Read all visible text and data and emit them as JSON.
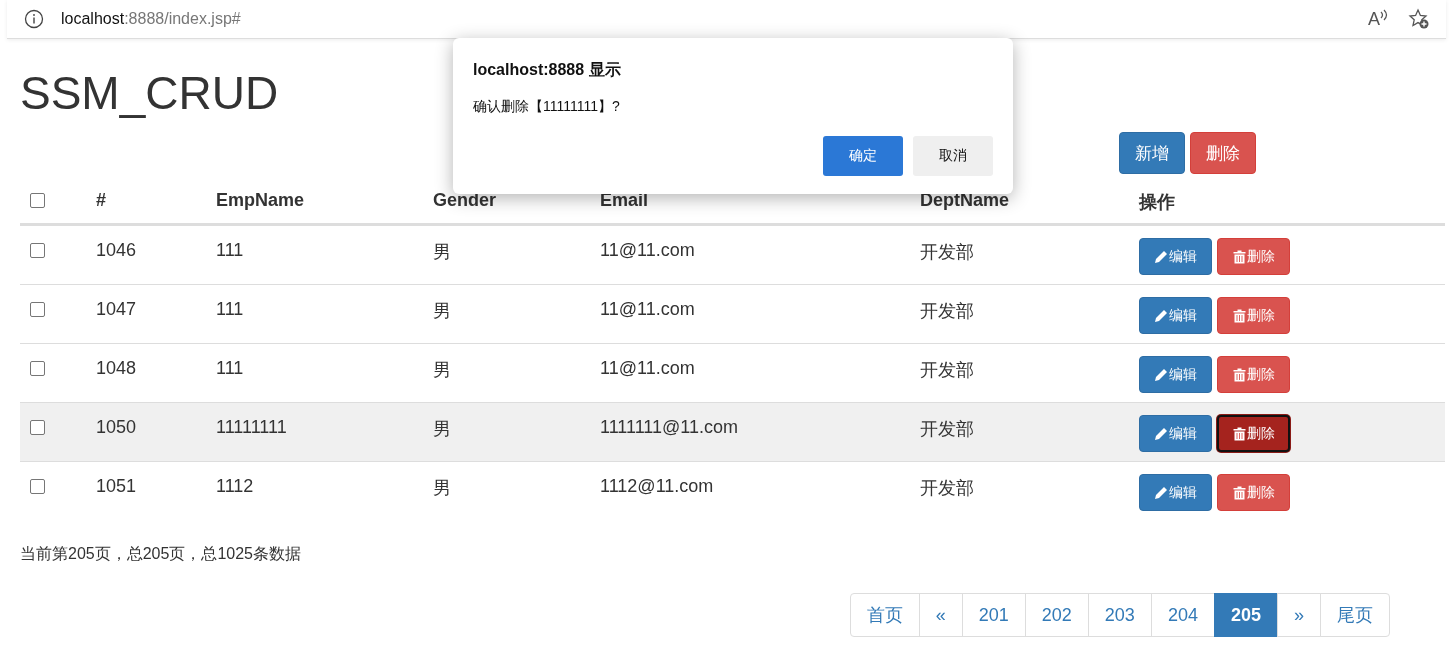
{
  "browser": {
    "url_host": "localhost",
    "url_path": ":8888/index.jsp#",
    "read_aloud_glyph": "A"
  },
  "title": "SSM_CRUD",
  "toolbar": [
    {
      "label": "新增",
      "kind": "primary"
    },
    {
      "label": "删除",
      "kind": "danger"
    }
  ],
  "table": {
    "select_all": {
      "checked": false
    },
    "columns": [
      "#",
      "EmpName",
      "Gender",
      "Email",
      "DeptName",
      "操作"
    ],
    "rows": [
      {
        "checked": false,
        "highlighted": false,
        "cells": [
          "1046",
          "111",
          "男",
          "11@11.com",
          "开发部"
        ],
        "edit": "编辑",
        "delete": "删除",
        "delete_focused": false
      },
      {
        "checked": false,
        "highlighted": false,
        "cells": [
          "1047",
          "111",
          "男",
          "11@11.com",
          "开发部"
        ],
        "edit": "编辑",
        "delete": "删除",
        "delete_focused": false
      },
      {
        "checked": false,
        "highlighted": false,
        "cells": [
          "1048",
          "111",
          "男",
          "11@11.com",
          "开发部"
        ],
        "edit": "编辑",
        "delete": "删除",
        "delete_focused": false
      },
      {
        "checked": false,
        "highlighted": true,
        "cells": [
          "1050",
          "11111111",
          "男",
          "1111111@11.com",
          "开发部"
        ],
        "edit": "编辑",
        "delete": "删除",
        "delete_focused": true
      },
      {
        "checked": false,
        "highlighted": false,
        "cells": [
          "1051",
          "1112",
          "男",
          "1112@11.com",
          "开发部"
        ],
        "edit": "编辑",
        "delete": "删除",
        "delete_focused": false
      }
    ]
  },
  "page_info": "当前第205页，总205页，总1025条数据",
  "pagination": [
    {
      "label": "首页",
      "selected": false
    },
    {
      "label": "«",
      "selected": false
    },
    {
      "label": "201",
      "selected": false
    },
    {
      "label": "202",
      "selected": false
    },
    {
      "label": "203",
      "selected": false
    },
    {
      "label": "204",
      "selected": false
    },
    {
      "label": "205",
      "selected": true
    },
    {
      "label": "»",
      "selected": false
    },
    {
      "label": "尾页",
      "selected": false
    }
  ],
  "dialog": {
    "title": "localhost:8888 显示",
    "message": "确认删除【11111111】?",
    "buttons": [
      {
        "label": "确定",
        "kind": "primary"
      },
      {
        "label": "取消",
        "kind": "secondary"
      }
    ]
  }
}
